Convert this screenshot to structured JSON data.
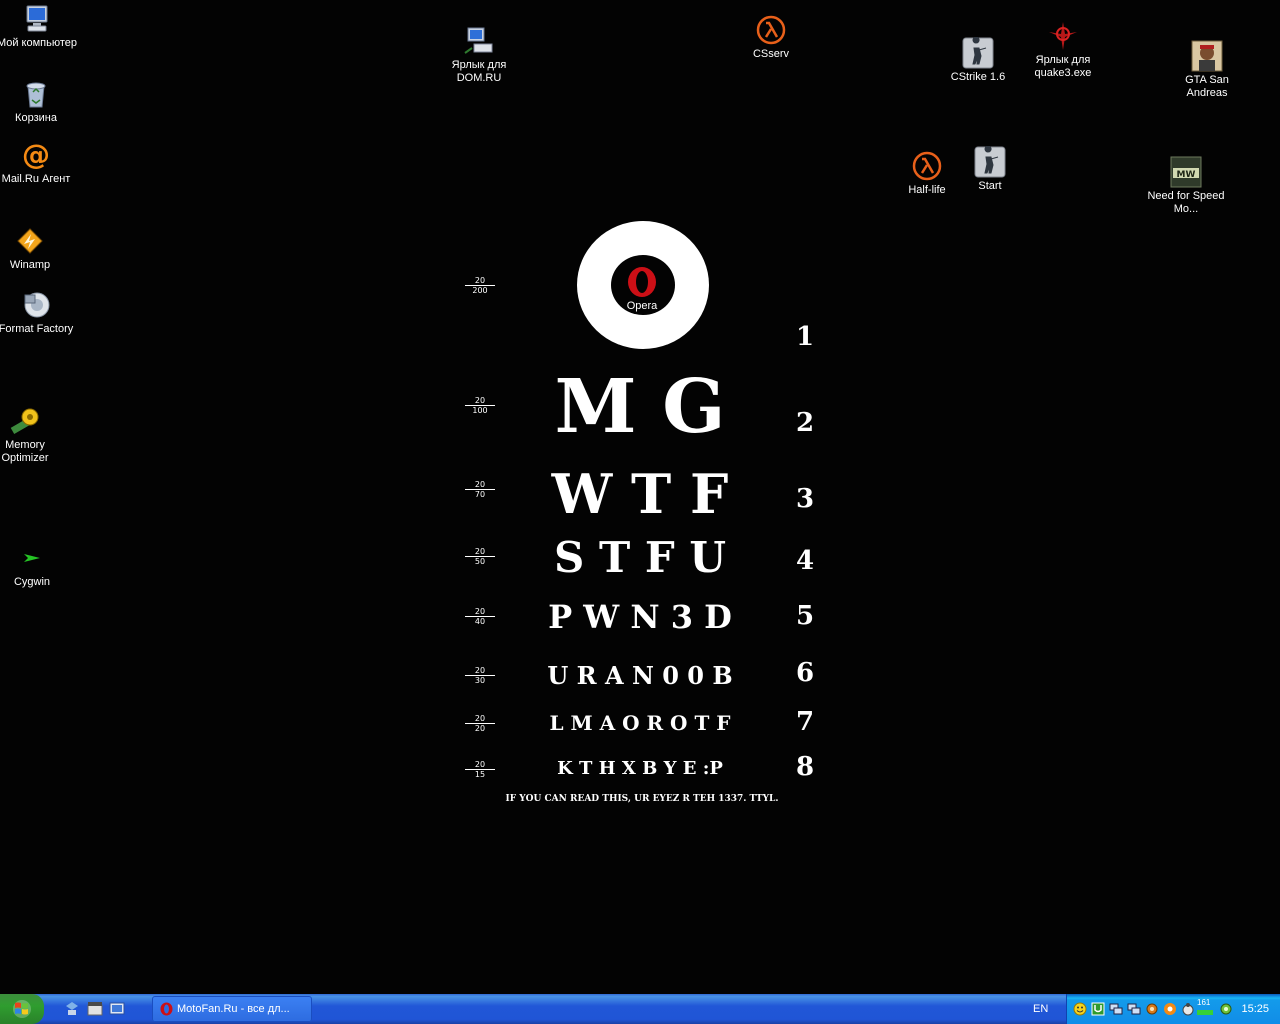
{
  "desktop_icons": [
    {
      "label": "Мой компьютер",
      "icon": "my-computer-icon"
    },
    {
      "label": "Корзина",
      "icon": "recycle-bin-icon"
    },
    {
      "label": "Mail.Ru Агент",
      "icon": "mailru-agent-icon"
    },
    {
      "label": "Winamp",
      "icon": "winamp-icon"
    },
    {
      "label": "Format Factory",
      "icon": "format-factory-icon"
    },
    {
      "label": "Memory Optimizer",
      "icon": "memory-optimizer-icon"
    },
    {
      "label": "Cygwin",
      "icon": "cygwin-icon"
    },
    {
      "label": "Ярлык для DOM.RU",
      "icon": "network-icon"
    },
    {
      "label": "CSserv",
      "icon": "half-life-lambda-icon"
    },
    {
      "label": "CStrike 1.6",
      "icon": "counter-strike-icon"
    },
    {
      "label": "Ярлык для quake3.exe",
      "icon": "quake3-icon"
    },
    {
      "label": "GTA San Andreas",
      "icon": "gta-sa-icon"
    },
    {
      "label": "Half-life",
      "icon": "half-life-lambda-icon"
    },
    {
      "label": "Start",
      "icon": "counter-strike-icon"
    },
    {
      "label": "Need for Speed Mo...",
      "icon": "nfs-mw-icon"
    },
    {
      "label": "Opera",
      "icon": "opera-icon"
    }
  ],
  "eye_chart": {
    "rows": [
      {
        "num": "1",
        "letters": "O",
        "frac_top": "20",
        "frac_bottom": "200"
      },
      {
        "num": "2",
        "letters": "M G",
        "frac_top": "20",
        "frac_bottom": "100"
      },
      {
        "num": "3",
        "letters": "W T F",
        "frac_top": "20",
        "frac_bottom": "70"
      },
      {
        "num": "4",
        "letters": "S T F U",
        "frac_top": "20",
        "frac_bottom": "50"
      },
      {
        "num": "5",
        "letters": "P W N 3 D",
        "frac_top": "20",
        "frac_bottom": "40"
      },
      {
        "num": "6",
        "letters": "U R A N 0 0 B",
        "frac_top": "20",
        "frac_bottom": "30"
      },
      {
        "num": "7",
        "letters": "L M A O R O T F",
        "frac_top": "20",
        "frac_bottom": "20"
      },
      {
        "num": "8",
        "letters": "K T H X B Y E :P",
        "frac_top": "20",
        "frac_bottom": "15"
      }
    ],
    "footer": "IF YOU CAN READ THIS, UR EYEZ R TEH 1337. TTYL."
  },
  "taskbar": {
    "task_button_label": "MotoFan.Ru - все дл...",
    "language": "EN",
    "clock": "15:25",
    "tray_badge": "161"
  },
  "colors": {
    "taskbar_blue": "#245edb",
    "start_green": "#3c9a3c",
    "opera_red": "#cc0f16",
    "lambda_orange": "#e8601a"
  }
}
